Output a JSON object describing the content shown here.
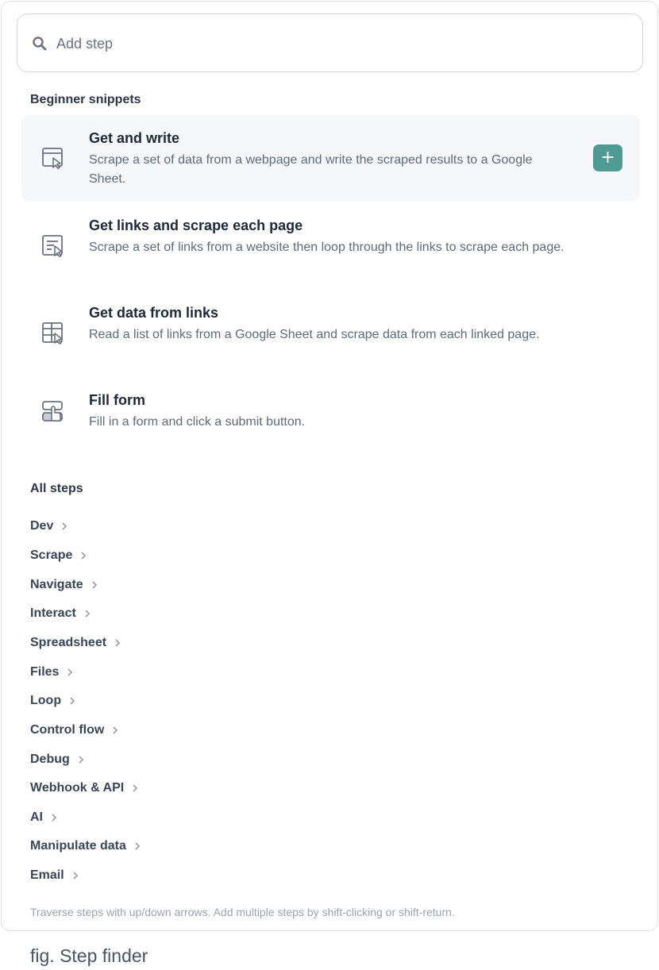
{
  "search": {
    "placeholder": "Add step",
    "icon": "search-icon"
  },
  "beginner": {
    "title": "Beginner snippets",
    "snippets": [
      {
        "title": "Get and write",
        "desc": "Scrape a set of data from a webpage and write the scraped results to a Google Sheet.",
        "icon": "browser-cursor-icon",
        "add_label": "+"
      },
      {
        "title": "Get links and scrape each page",
        "desc": "Scrape a set of links from a website then loop through the links to scrape each page.",
        "icon": "list-cursor-icon"
      },
      {
        "title": "Get data from links",
        "desc": "Read a list of links from a Google Sheet and scrape data from each linked page.",
        "icon": "table-cursor-icon"
      },
      {
        "title": "Fill form",
        "desc": "Fill in a form and click a submit button.",
        "icon": "form-click-icon"
      }
    ]
  },
  "all_steps": {
    "title": "All steps",
    "categories": [
      "Dev",
      "Scrape",
      "Navigate",
      "Interact",
      "Spreadsheet",
      "Files",
      "Loop",
      "Control flow",
      "Debug",
      "Webhook & API",
      "AI",
      "Manipulate data",
      "Email"
    ]
  },
  "hint": "Traverse steps with up/down arrows. Add multiple steps by shift-clicking or shift-return.",
  "caption": "fig. Step finder",
  "colors": {
    "accent": "#4e9a95",
    "selected_bg": "#f5f7fa",
    "border": "#dde2ea"
  }
}
